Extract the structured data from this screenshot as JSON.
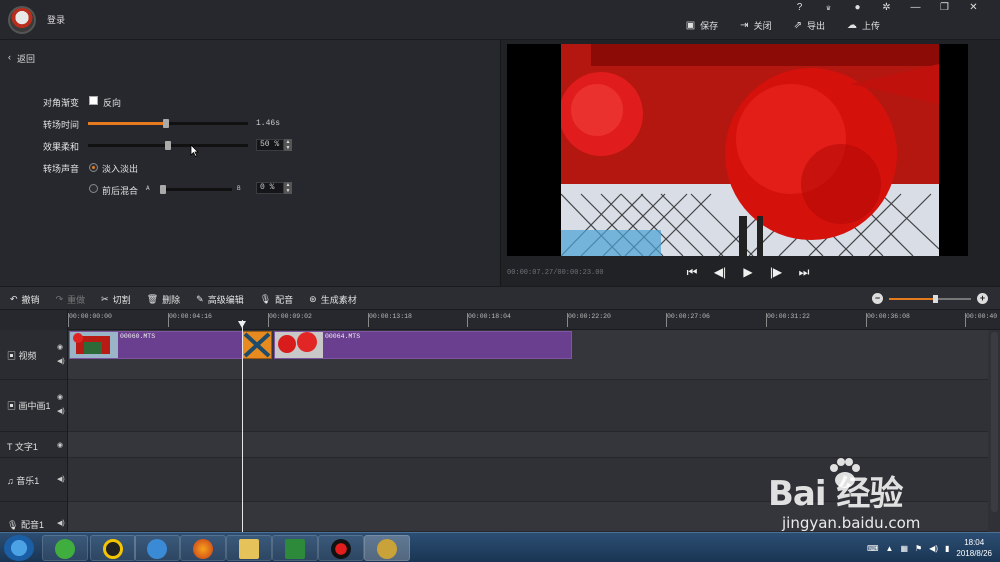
{
  "header": {
    "login": "登录",
    "top_icons": [
      "?",
      "VIP",
      "bell",
      "gear",
      "—",
      "❐",
      "✕"
    ],
    "actions": [
      {
        "icon": "save-icon",
        "label": "保存"
      },
      {
        "icon": "close-doc-icon",
        "label": "关闭"
      },
      {
        "icon": "export-icon",
        "label": "导出"
      },
      {
        "icon": "upload-icon",
        "label": "上传"
      }
    ]
  },
  "settings": {
    "back": "返回",
    "diagonal_fade": {
      "label": "对角渐变",
      "reverse_label": "反向",
      "checked": false
    },
    "transition_time": {
      "label": "转场时间",
      "value_text": "1.46s",
      "fraction": 0.5
    },
    "softness": {
      "label": "效果柔和",
      "value_text": "50 %",
      "fraction": 0.5
    },
    "sound": {
      "label": "转场声音",
      "option1": "淡入淡出",
      "option2": "前后混合",
      "a": "A",
      "b": "B",
      "mix_value": "0 %",
      "selected": "option1"
    }
  },
  "preview": {
    "timecode": "00:00:07.27/00:00:23.00",
    "controls": [
      "⏮",
      "⏴",
      "▶",
      "⏵",
      "⏭"
    ]
  },
  "toolbar": {
    "undo": "撤销",
    "redo": "重做",
    "cut": "切割",
    "delete": "删除",
    "advanced": "高级编辑",
    "dub": "配音",
    "generate": "生成素材"
  },
  "timeline": {
    "ticks": [
      "00:00:00:00",
      "00:00:04:16",
      "00:00:09:02",
      "00:00:13:18",
      "00:00:18:04",
      "00:00:22:20",
      "00:00:27:06",
      "00:00:31:22",
      "00:00:36:08",
      "00:00:40"
    ],
    "tracks": {
      "video": "视频",
      "pip": "画中画1",
      "text": "文字1",
      "music": "音乐1",
      "dub": "配音1"
    },
    "clips": [
      {
        "name": "00060.MTS"
      },
      {
        "name": "00064.MTS"
      }
    ]
  },
  "taskbar": {
    "time": "18:04",
    "date": "2018/8/26"
  },
  "watermark": {
    "brand": "Bai 经验",
    "url": "jingyan.baidu.com"
  },
  "colors": {
    "accent": "#e57b1e",
    "clip": "#6a3f8f",
    "panel": "#26282d"
  }
}
